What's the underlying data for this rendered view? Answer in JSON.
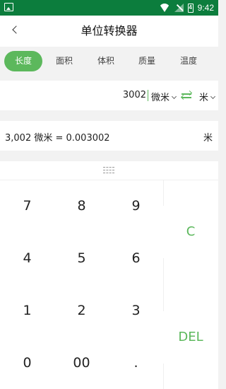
{
  "statusbar": {
    "time": "9:42",
    "battery_glyph": "4"
  },
  "header": {
    "title": "单位转换器"
  },
  "tabs": [
    {
      "label": "长度",
      "active": true
    },
    {
      "label": "面积",
      "active": false
    },
    {
      "label": "体积",
      "active": false
    },
    {
      "label": "质量",
      "active": false
    },
    {
      "label": "温度",
      "active": false
    }
  ],
  "converter": {
    "input_value": "3002",
    "from_unit": "微米",
    "to_unit": "米",
    "result_text": "3,002 微米 = 0.003002",
    "result_unit": "米"
  },
  "keypad": {
    "keys": [
      "7",
      "8",
      "9",
      "4",
      "5",
      "6",
      "1",
      "2",
      "3",
      "0",
      "00",
      "."
    ],
    "clear_label": "C",
    "delete_label": "DEL"
  },
  "colors": {
    "status_bar": "#0c7d3d",
    "accent": "#5cb85c"
  }
}
